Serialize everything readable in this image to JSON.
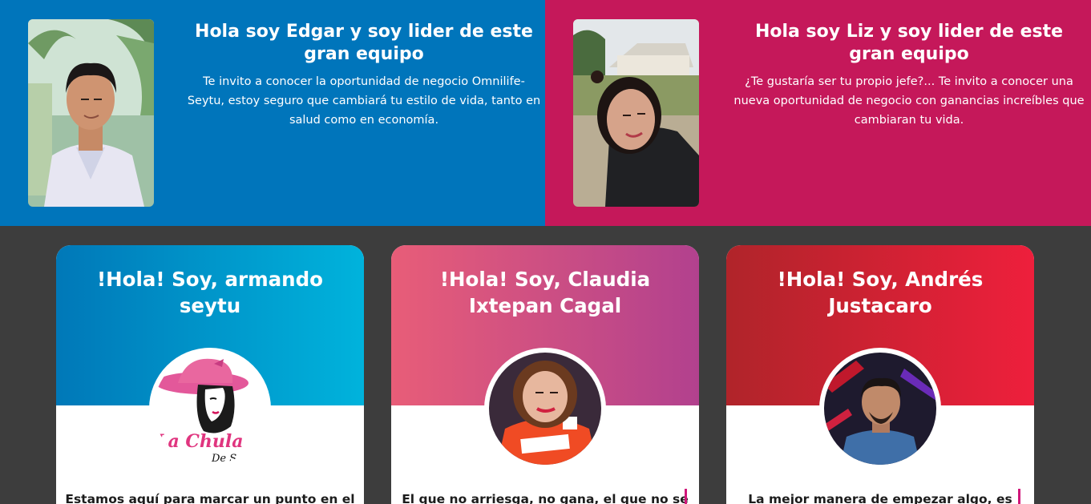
{
  "leaders": [
    {
      "title": "Hola soy Edgar y soy lider de este gran equipo",
      "description": "Te invito a conocer la oportunidad de negocio Omnilife-Seytu, estoy seguro que cambiará tu estilo de vida, tanto en salud como en economía.",
      "color": "#0075bb"
    },
    {
      "title": "Hola soy Liz y soy lider de este gran equipo",
      "description": "¿Te gustaría ser tu propio jefe?... Te invito a conocer una nueva oportunidad de negocio con ganancias increíbles que cambiaran tu vida.",
      "color": "#c5185a"
    }
  ],
  "cards": [
    {
      "title": "!Hola! Soy, armando seytu",
      "logo_text": "La Chula",
      "logo_sub": "De S",
      "quote": "Estamos aquí para marcar un punto en el",
      "gradient": [
        "#0078b8",
        "#00b3dc"
      ]
    },
    {
      "title": "!Hola! Soy, Claudia Ixtepan Cagal",
      "quote": "El que no arriesga, no gana, el que no se",
      "gradient": [
        "#e85d78",
        "#b2418e"
      ]
    },
    {
      "title": "!Hola! Soy, Andrés Justacaro",
      "quote": "La mejor manera de empezar algo, es",
      "gradient": [
        "#b0242a",
        "#ee1f3c"
      ]
    }
  ]
}
